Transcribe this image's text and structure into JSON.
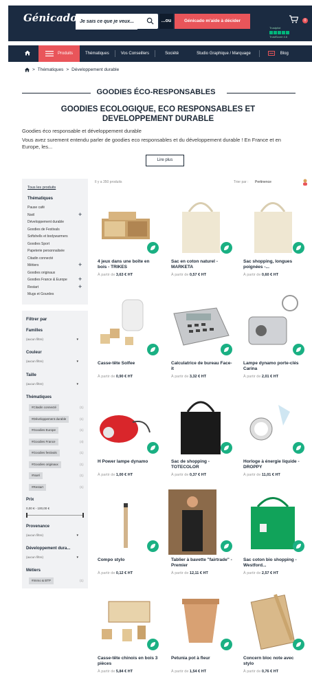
{
  "header": {
    "logo": "Génicado",
    "search_placeholder": "Je sais ce que je veux...",
    "or_label": "...ou",
    "help_button": "Génicado m'aide à décider",
    "trust_label": "Trustpilot",
    "trust_score": "TrustScore 4.6",
    "cart_count": "0"
  },
  "nav": {
    "home_icon": "home-icon",
    "items": [
      "Produits",
      "Thématiques",
      "Vos Conseillers",
      "Société",
      "Studio Graphique / Marquage",
      "Blog"
    ]
  },
  "breadcrumb": {
    "home_icon": "home-icon",
    "items": [
      "Thématiques",
      "Développement durable"
    ]
  },
  "page": {
    "title": "GOODIES ÉCO-RESPONSABLES",
    "subtitle": "GOODIES ECOLOGIQUE, ECO RESPONSABLES ET DEVELOPPEMENT DURABLE",
    "intro1": "Goodies éco responsable et développement durable",
    "intro2": "Vous avez surement entendu parler de goodies eco responsables et du développement durable ! En France et en Europe, les...",
    "readmore": "Lire plus"
  },
  "sidebar": {
    "all_products": "Tous les produits",
    "themes_title": "Thématiques",
    "themes": [
      {
        "label": "Pause café",
        "plus": false
      },
      {
        "label": "Noël",
        "plus": true
      },
      {
        "label": "Développement durable",
        "plus": false
      },
      {
        "label": "Goodies de Festivals",
        "plus": false
      },
      {
        "label": "Softshells et bodywarmers",
        "plus": false
      },
      {
        "label": "Goodies Sport",
        "plus": false
      },
      {
        "label": "Papeterie personnalisée",
        "plus": false
      },
      {
        "label": "Citadin connecté",
        "plus": false
      },
      {
        "label": "Métiers",
        "plus": true
      },
      {
        "label": "Goodies originaux",
        "plus": false
      },
      {
        "label": "Goodies France & Europe",
        "plus": true
      },
      {
        "label": "Restart",
        "plus": true
      },
      {
        "label": "Mugs et Gourdes",
        "plus": false
      }
    ],
    "filter_title": "Filtrer par",
    "families_label": "Familles",
    "families_value": "(aucun filtre)",
    "color_label": "Couleur",
    "color_value": "(aucun filtre)",
    "size_label": "Taille",
    "size_value": "(aucun filtre)",
    "themes_filter_label": "Thématiques",
    "theme_tags": [
      {
        "label": "#Citadin connecté",
        "count": "(1)"
      },
      {
        "label": "#Développement durable",
        "count": "(1)"
      },
      {
        "label": "#Goodies Europe",
        "count": "(1)"
      },
      {
        "label": "#Goodies France",
        "count": "(4)"
      },
      {
        "label": "#Goodies festivals",
        "count": "(1)"
      },
      {
        "label": "#Goodies originaux",
        "count": "(1)"
      },
      {
        "label": "#Noël",
        "count": "(1)"
      },
      {
        "label": "#Restart",
        "count": "(1)"
      }
    ],
    "price_label": "Prix",
    "price_range": "0,00 € - 100,00 €",
    "provenance_label": "Provenance",
    "provenance_value": "(aucun filtre)",
    "dev_label": "Développement dura...",
    "dev_value": "(aucun filtre)",
    "metiers_label": "Métiers",
    "metiers_tag": "#Immo & BTP",
    "metiers_count": "(1)"
  },
  "toolbar": {
    "count": "Il y a 350 produits",
    "sort_label": "Trier par :",
    "sort_value": "Pertinence"
  },
  "products": [
    {
      "name": "4 jeux dans une boîte en bois - TRIKES",
      "from": "À partir de",
      "price": "3,63 € HT",
      "img": "wooden-games"
    },
    {
      "name": "Sac en coton naturel - MARKETA",
      "from": "À partir de",
      "price": "0,57 € HT",
      "img": "cotton-bag"
    },
    {
      "name": "Sac shopping, longues poignées -...",
      "from": "À partir de",
      "price": "0,60 € HT",
      "img": "cotton-bag"
    },
    {
      "name": "Casse-tête Solfee",
      "from": "À partir de",
      "price": "0,90 € HT",
      "img": "puzzle"
    },
    {
      "name": "Calculatrice de bureau Face-it",
      "from": "À partir de",
      "price": "3,32 € HT",
      "img": "calculator"
    },
    {
      "name": "Lampe dynamo porte-clés Carina",
      "from": "À partir de",
      "price": "2,01 € HT",
      "img": "dynamo-keychain"
    },
    {
      "name": "H Power lampe dynamo",
      "from": "À partir de",
      "price": "1,00 € HT",
      "img": "red-torch"
    },
    {
      "name": "Sac de shopping - TOTECOLOR",
      "from": "À partir de",
      "price": "0,37 € HT",
      "img": "black-bag"
    },
    {
      "name": "Horloge à énergie liquide - DROPPY",
      "from": "À partir de",
      "price": "11,01 € HT",
      "img": "clock"
    },
    {
      "name": "Compo stylo",
      "from": "À partir de",
      "price": "0,12 € HT",
      "img": "pen"
    },
    {
      "name": "Tablier à bavette \"fairtrade\" - Premier",
      "from": "À partir de",
      "price": "12,11 € HT",
      "img": "apron"
    },
    {
      "name": "Sac coton bio shopping - Westford...",
      "from": "À partir de",
      "price": "2,57 € HT",
      "img": "green-bag"
    },
    {
      "name": "Casse-tête chinois en bois 3 pièces",
      "from": "À partir de",
      "price": "5,84 € HT",
      "img": "wooden-box"
    },
    {
      "name": "Petunia pot à fleur",
      "from": "À partir de",
      "price": "1,54 € HT",
      "img": "flower-pot"
    },
    {
      "name": "Concern bloc note avec stylo",
      "from": "À partir de",
      "price": "0,76 € HT",
      "img": "notebook"
    }
  ],
  "colors": {
    "navy": "#1b2b41",
    "coral": "#e9555a",
    "green": "#1ab083"
  }
}
